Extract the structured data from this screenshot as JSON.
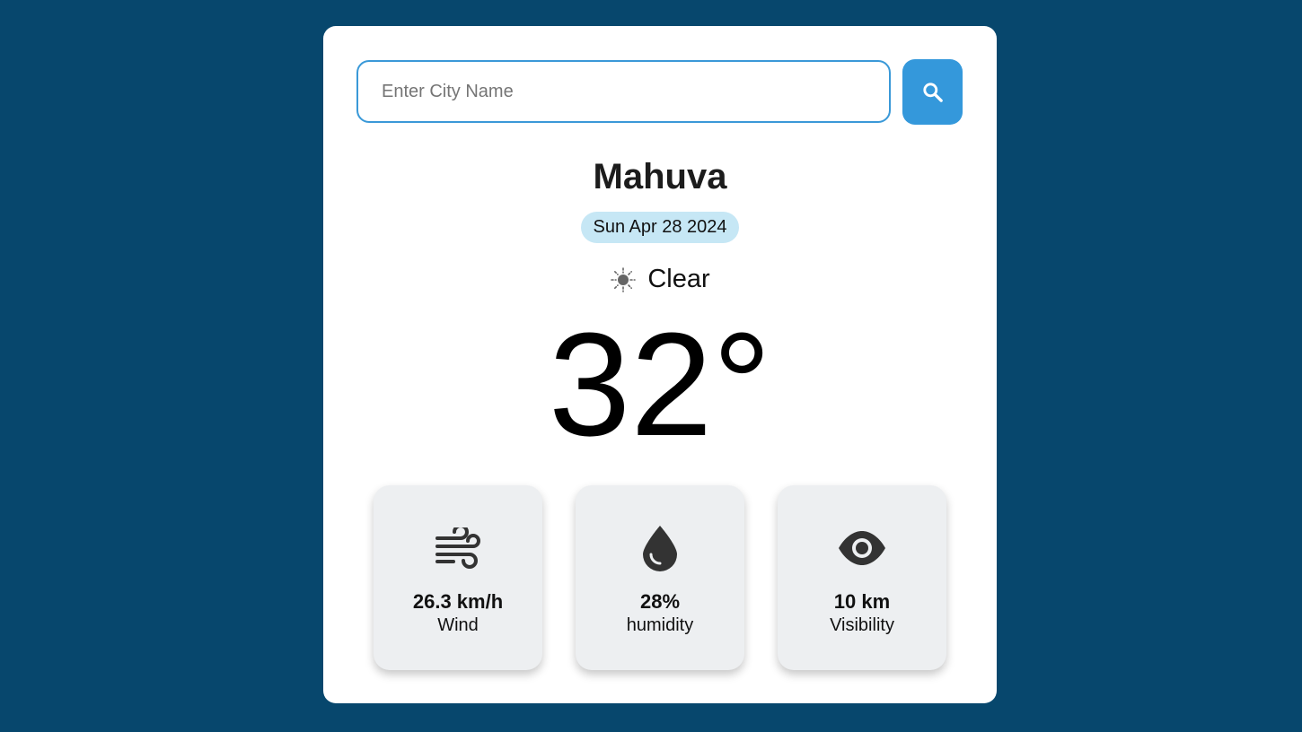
{
  "search": {
    "placeholder": "Enter City Name",
    "value": "",
    "button_icon": "search-icon"
  },
  "weather": {
    "city": "Mahuva",
    "date": "Sun Apr 28 2024",
    "condition": "Clear",
    "condition_icon": "sun-icon",
    "temperature": "32°"
  },
  "stats": [
    {
      "value": "26.3 km/h",
      "label": "Wind",
      "icon": "wind-icon"
    },
    {
      "value": "28%",
      "label": "humidity",
      "icon": "water-drop-icon"
    },
    {
      "value": "10 km",
      "label": "Visibility",
      "icon": "eye-icon"
    }
  ],
  "colors": {
    "background": "#07476d",
    "accent": "#3498db",
    "date_badge": "#c6e7f5",
    "stat_card": "#edeff1"
  }
}
